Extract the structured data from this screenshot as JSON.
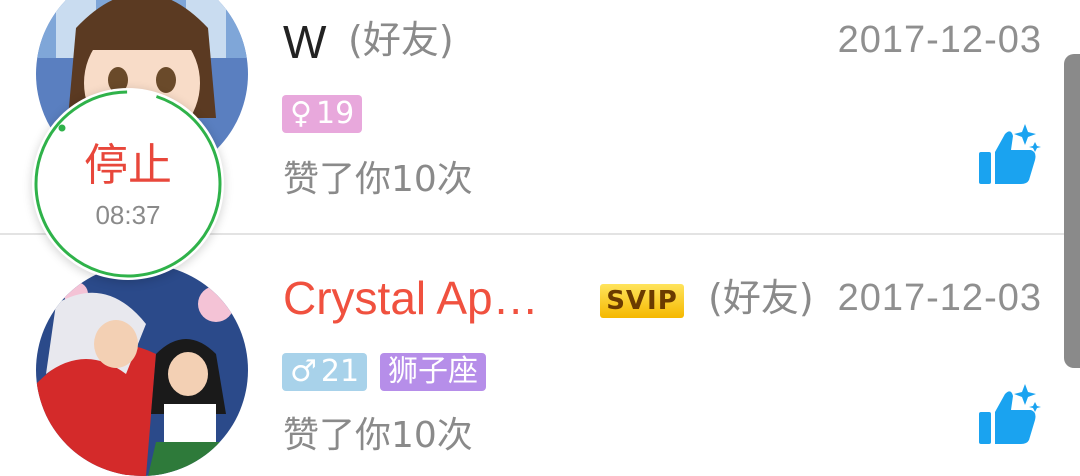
{
  "likes": [
    {
      "name": "W",
      "relation": "(好友)",
      "date": "2017-12-03",
      "gender_symbol": "♀",
      "age": "19",
      "liked_text": "赞了你10次"
    },
    {
      "name": "Crystal Ap…",
      "vip_badge": "SVIP",
      "relation": "(好友)",
      "date": "2017-12-03",
      "gender_symbol": "♂",
      "age": "21",
      "zodiac": "狮子座",
      "liked_text": "赞了你10次"
    }
  ],
  "record": {
    "label": "停止",
    "time": "08:37"
  },
  "colors": {
    "female_tag": "#e8a8dc",
    "male_tag": "#a8d2ea",
    "zodiac_tag": "#b68ee9",
    "vip_name": "#f0513f",
    "like_icon": "#1aa3f0",
    "record_ring": "#2fb24a",
    "record_label": "#e8473b"
  },
  "icons": {
    "like": "thumbs-up-sparkle-icon"
  }
}
